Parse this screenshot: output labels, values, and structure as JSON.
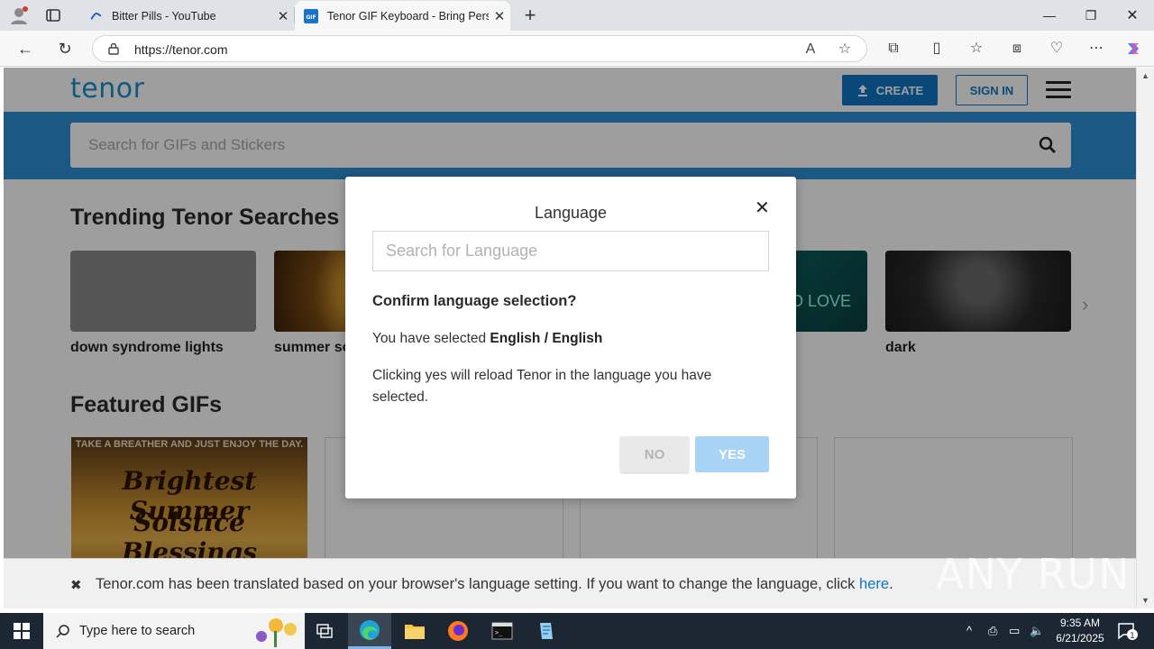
{
  "browser": {
    "tabs": [
      {
        "title": "Bitter Pills - YouTube",
        "active": false
      },
      {
        "title": "Tenor GIF Keyboard - Bring Perso",
        "active": true
      }
    ],
    "url": "https://tenor.com"
  },
  "tenor": {
    "logo": "tenor",
    "create_label": "CREATE",
    "signin_label": "SIGN IN",
    "search_placeholder": "Search for GIFs and Stickers",
    "trending_title": "Trending Tenor Searches",
    "trending": [
      {
        "label": "down syndrome lights"
      },
      {
        "label": "summer so"
      },
      {
        "label": ""
      },
      {
        "label": ""
      },
      {
        "label": "dark"
      }
    ],
    "featured_title": "Featured GIFs",
    "featured_gif": {
      "top_text": "TAKE A BREATHER AND JUST ENJOY THE DAY.",
      "line1": "Brightest Summer",
      "line2": "Solstice Blessings"
    },
    "teal_thumb_text": "D LOVE",
    "banner_text": "Tenor.com has been translated based on your browser's language setting. If you want to change the language, click ",
    "banner_link": "here",
    "banner_end": "."
  },
  "dialog": {
    "title": "Language",
    "search_placeholder": "Search for Language",
    "confirm": "Confirm language selection?",
    "selected_prefix": "You have selected ",
    "selected_value": "English / English",
    "note": "Clicking yes will reload Tenor in the language you have selected.",
    "no_label": "NO",
    "yes_label": "YES"
  },
  "watermark": "ANY RUN",
  "taskbar": {
    "search_placeholder": "Type here to search",
    "time": "9:35 AM",
    "date": "6/21/2025",
    "notification_count": "1"
  }
}
